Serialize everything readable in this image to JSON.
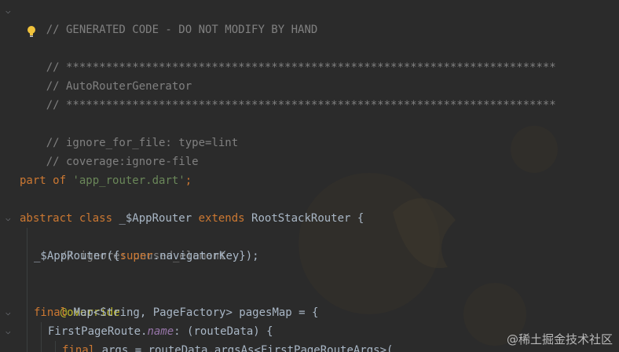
{
  "editor": {
    "lines": {
      "l1": "// GENERATED CODE - DO NOT MODIFY BY HAND",
      "l3": "// **************************************************************************",
      "l4": "// AutoRouterGenerator",
      "l5": "// **************************************************************************",
      "l7": "// ignore_for_file: type=lint",
      "l8": "// coverage:ignore-file",
      "l10_part": "part of ",
      "l10_str": "'app_router.dart'",
      "l10_semi": ";",
      "l12_abstract": "abstract class ",
      "l12_name": "_$AppRouter ",
      "l12_extends": "extends ",
      "l12_super": "RootStackRouter {",
      "l13": "// ignore: unused_element",
      "l14_a": "_$AppRouter({",
      "l14_super": "super",
      "l14_b": ".navigatorKey});",
      "l16": "@override",
      "l17_final": "final ",
      "l17_rest": "Map<String, PageFactory> pagesMap = {",
      "l18_a": "FirstPageRoute.",
      "l18_name": "name",
      "l18_b": ": (routeData) {",
      "l19_final": "final ",
      "l19_rest": "args = routeData.argsAs<FirstPageRouteArgs>("
    }
  },
  "watermark": "@稀土掘金技术社区",
  "icons": {
    "bulb": "lightbulb-icon",
    "fold": "fold-chevron-icon"
  },
  "colors": {
    "background": "#2b2b2b",
    "comment": "#808080",
    "keyword": "#cc7832",
    "string": "#6a8759",
    "text": "#a9b7c6",
    "annotation": "#bbb529",
    "field": "#9876aa"
  }
}
